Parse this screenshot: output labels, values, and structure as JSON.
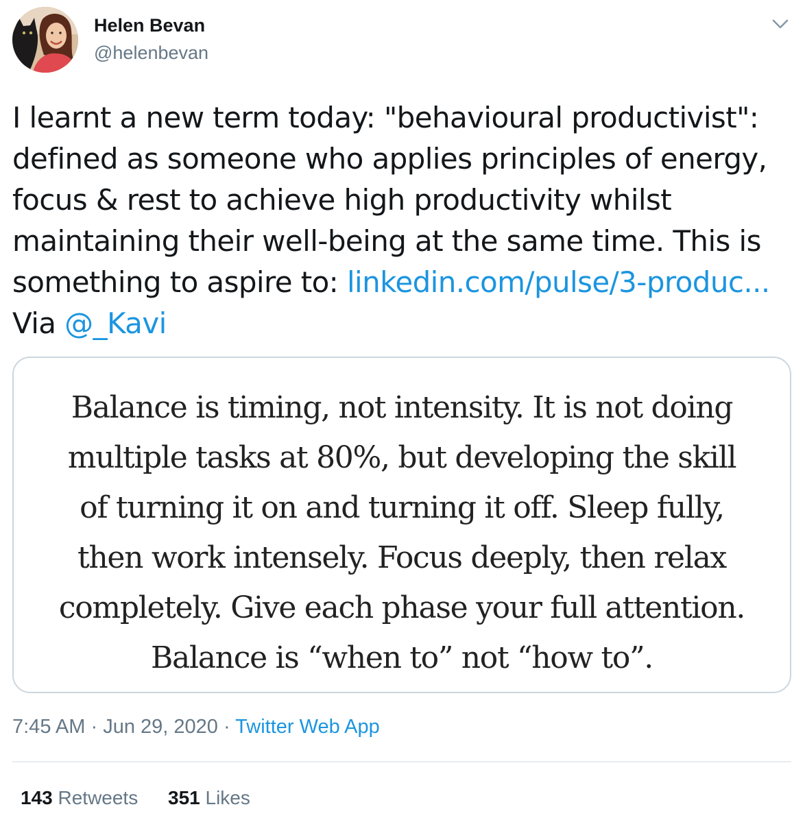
{
  "author": {
    "display_name": "Helen Bevan",
    "handle": "@helenbevan",
    "avatar_icon": "profile-photo-with-cat"
  },
  "menu_icon": "chevron-down-icon",
  "tweet": {
    "lines": [
      "I learnt a new term today: \"behavioural productivist\":",
      "defined as someone who applies principles of energy,",
      "focus & rest to achieve high productivity whilst",
      "maintaining their well-being at the same time. This is"
    ],
    "line5_prefix": "something to aspire to: ",
    "link_text": "linkedin.com/pulse/3-produc...",
    "via_prefix": "Via ",
    "mention": "@_Kavi"
  },
  "image_quote": {
    "lines": [
      "Balance is timing, not intensity. It is not doing",
      "multiple tasks at 80%, but developing the skill",
      "of turning it on and turning it off. Sleep fully,",
      "then work intensely. Focus deeply, then relax",
      "completely. Give each phase your full attention.",
      "Balance is “when to” not “how to”."
    ]
  },
  "meta": {
    "time": "7:45 AM",
    "separator": " · ",
    "date": "Jun 29, 2020",
    "source": "Twitter Web App"
  },
  "stats": {
    "retweets_count": "143",
    "retweets_label": " Retweets",
    "likes_count": "351",
    "likes_label": " Likes"
  },
  "colors": {
    "link": "#1b95e0",
    "secondary_text": "#657786",
    "primary_text": "#14171a",
    "border": "#ccd6dd"
  }
}
